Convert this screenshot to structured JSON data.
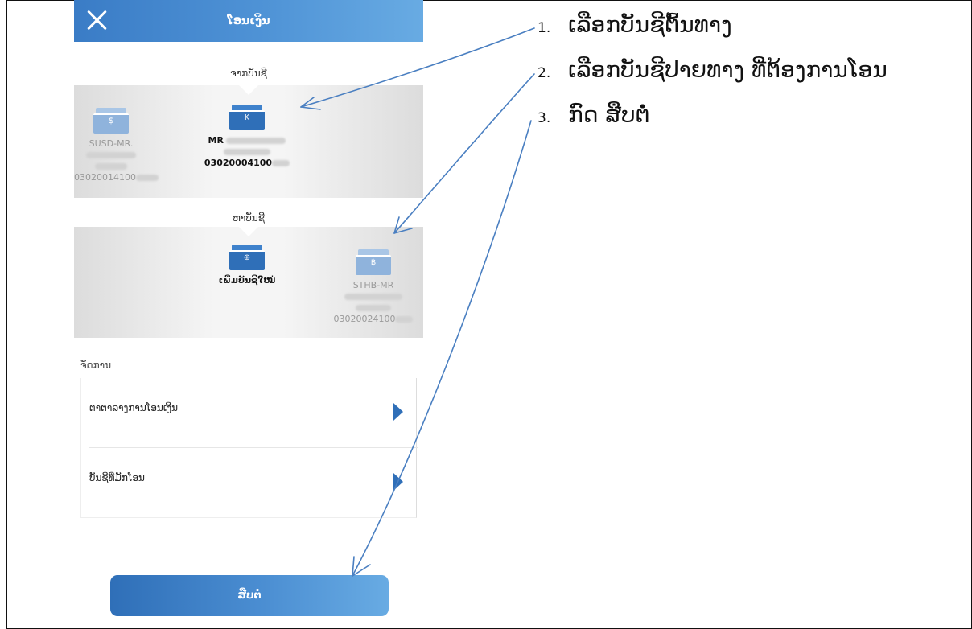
{
  "header": {
    "title": "ໂອນເງິນ",
    "close_icon": "close-icon"
  },
  "from_section": {
    "label": "ຈາກບັນຊີ",
    "accounts": [
      {
        "name": "SUSD-MR.",
        "number": "03020014100",
        "symbol": "$",
        "state": "dim"
      },
      {
        "name": "MR",
        "number": "03020004100",
        "symbol": "₭",
        "state": "active"
      }
    ]
  },
  "to_section": {
    "label": "ຫາບັນຊີ",
    "accounts": [
      {
        "name": "ເພີ່ມບັນຊີໃໝ່",
        "symbol": "⊕",
        "state": "active"
      },
      {
        "name": "STHB-MR",
        "number": "03020024100",
        "symbol": "฿",
        "state": "dim"
      }
    ]
  },
  "manage": {
    "label": "ຈັດການ",
    "items": [
      {
        "label": "ຕາຕາລາງການໂອນເງິນ",
        "icon": "chevron-right-icon"
      },
      {
        "label": "ບັນຊີທີ່ມັກໂອນ",
        "icon": "chevron-right-icon"
      }
    ]
  },
  "next_button": {
    "label": "ສືບຕໍ່"
  },
  "instructions": [
    {
      "num": "1.",
      "text": "ເລືອກບັນຊີຕົ້ນທາງ"
    },
    {
      "num": "2.",
      "text": "ເລືອກບັນຊີປາຍທາງ ທີ່ຕ້ອງການໂອນ"
    },
    {
      "num": "3.",
      "text": "ກົດ ສືບຕໍ່"
    }
  ],
  "colors": {
    "primary": "#2f6fb8",
    "accent": "#68abe3",
    "arrow": "#4a7fc1"
  }
}
